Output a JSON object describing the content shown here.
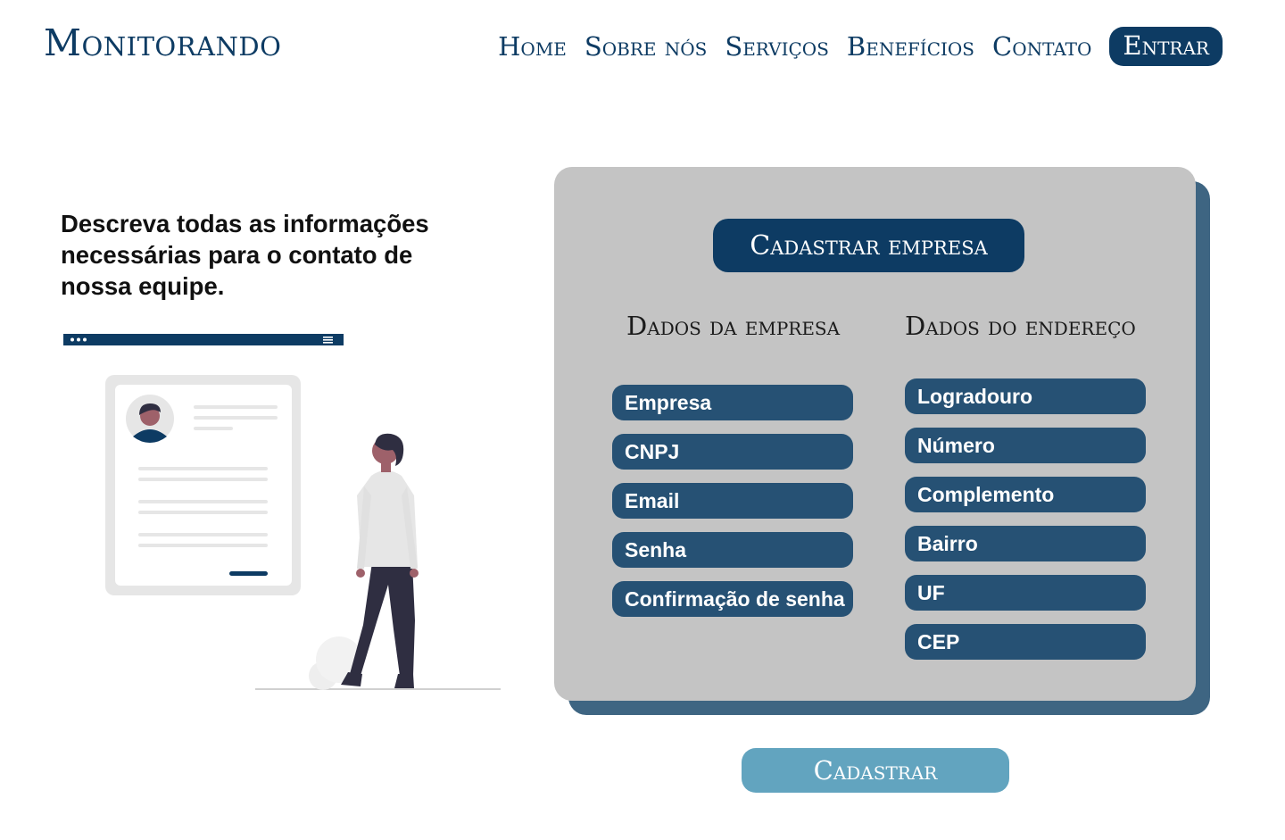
{
  "header": {
    "logo": "Monitorando",
    "nav": [
      {
        "label": "Home"
      },
      {
        "label": "Sobre nós"
      },
      {
        "label": "Serviços"
      },
      {
        "label": "Benefícios"
      },
      {
        "label": "Contato"
      }
    ],
    "login_label": "Entrar"
  },
  "intro": {
    "text": "Descreva todas as informações necessárias para o contato de nossa equipe."
  },
  "form": {
    "title": "Cadastrar empresa",
    "company": {
      "heading": "Dados da empresa",
      "fields": [
        "Empresa",
        "CNPJ",
        "Email",
        "Senha",
        "Confirmação de senha"
      ]
    },
    "address": {
      "heading": "Dados do endereço",
      "fields": [
        "Logradouro",
        "Número",
        "Complemento",
        "Bairro",
        "UF",
        "CEP"
      ]
    },
    "submit_label": "Cadastrar"
  },
  "colors": {
    "primary": "#0d3b63",
    "field": "#265174",
    "card": "#c4c4c4",
    "card_shadow": "#3e6582",
    "submit": "#62a4bf"
  }
}
